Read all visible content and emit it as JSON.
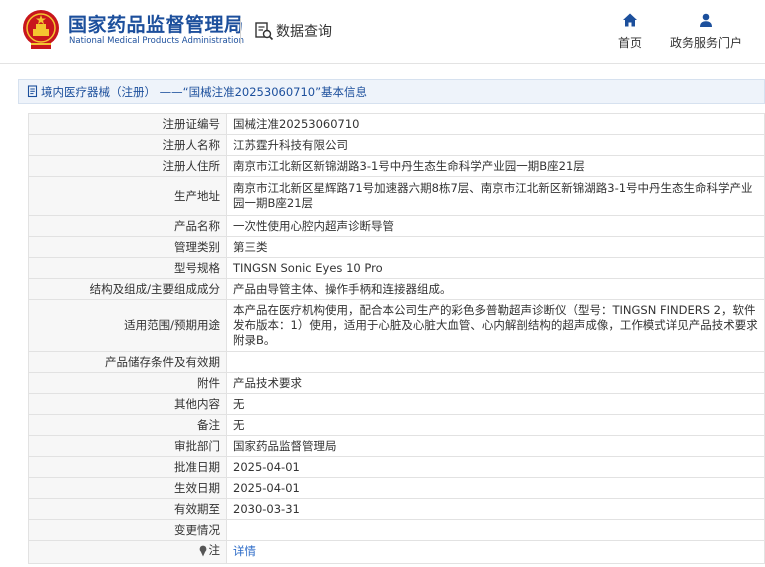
{
  "header": {
    "org_name_cn": "国家药品监督管理局",
    "org_name_en": "National Medical Products Administration",
    "query_label": "数据查询",
    "nav": [
      {
        "label": "首页",
        "icon": "home-icon"
      },
      {
        "label": "政务服务门户",
        "icon": "user-icon"
      }
    ]
  },
  "breadcrumb": {
    "text": "境内医疗器械（注册） ——“国械注准20253060710”基本信息"
  },
  "colors": {
    "brand_blue": "#1c4f9c",
    "link_blue": "#2a6ac7",
    "label_bg": "#f7f7f7",
    "border": "#e2e2e2"
  },
  "table": {
    "rows": [
      {
        "label": "注册证编号",
        "value": "国械注准20253060710"
      },
      {
        "label": "注册人名称",
        "value": "江苏霆升科技有限公司"
      },
      {
        "label": "注册人住所",
        "value": "南京市江北新区新锦湖路3-1号中丹生态生命科学产业园一期B座21层"
      },
      {
        "label": "生产地址",
        "value": "南京市江北新区星辉路71号加速器六期8栋7层、南京市江北新区新锦湖路3-1号中丹生态生命科学产业园一期B座21层"
      },
      {
        "label": "产品名称",
        "value": "一次性使用心腔内超声诊断导管"
      },
      {
        "label": "管理类别",
        "value": "第三类"
      },
      {
        "label": "型号规格",
        "value": "TINGSN Sonic Eyes 10 Pro"
      },
      {
        "label": "结构及组成/主要组成成分",
        "value": "产品由导管主体、操作手柄和连接器组成。"
      },
      {
        "label": "适用范围/预期用途",
        "value": "本产品在医疗机构使用，配合本公司生产的彩色多普勒超声诊断仪（型号：TINGSN FINDERS 2，软件发布版本：1）使用，适用于心脏及心脏大血管、心内解剖结构的超声成像，工作模式详见产品技术要求附录B。"
      },
      {
        "label": "产品储存条件及有效期",
        "value": ""
      },
      {
        "label": "附件",
        "value": "产品技术要求"
      },
      {
        "label": "其他内容",
        "value": "无"
      },
      {
        "label": "备注",
        "value": "无"
      },
      {
        "label": "审批部门",
        "value": "国家药品监督管理局"
      },
      {
        "label": "批准日期",
        "value": "2025-04-01"
      },
      {
        "label": "生效日期",
        "value": "2025-04-01"
      },
      {
        "label": "有效期至",
        "value": "2030-03-31"
      },
      {
        "label": "变更情况",
        "value": ""
      },
      {
        "label": "注",
        "value": "详情"
      }
    ]
  }
}
